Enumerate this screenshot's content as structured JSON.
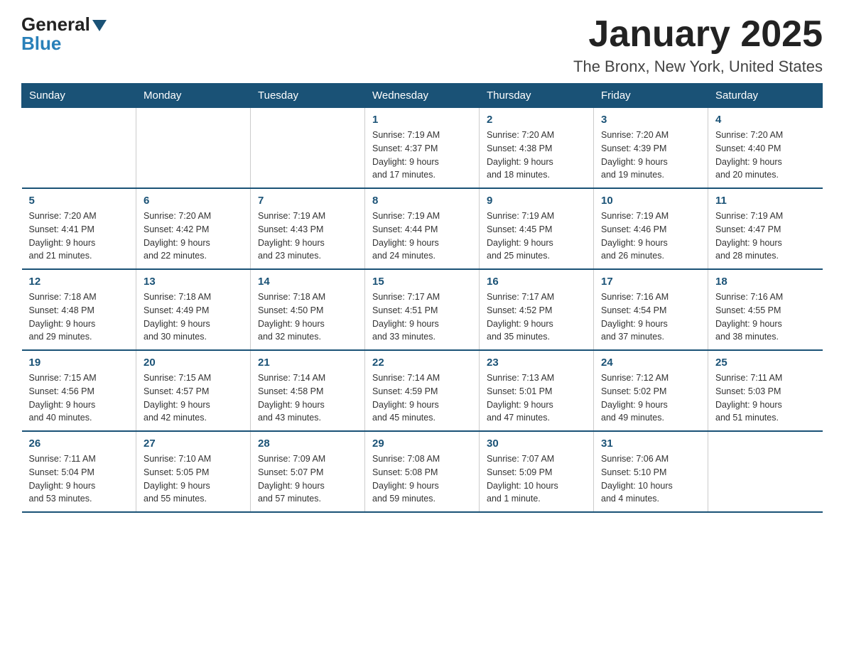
{
  "logo": {
    "general": "General",
    "blue": "Blue"
  },
  "header": {
    "month": "January 2025",
    "location": "The Bronx, New York, United States"
  },
  "weekdays": [
    "Sunday",
    "Monday",
    "Tuesday",
    "Wednesday",
    "Thursday",
    "Friday",
    "Saturday"
  ],
  "weeks": [
    [
      {
        "day": "",
        "info": ""
      },
      {
        "day": "",
        "info": ""
      },
      {
        "day": "",
        "info": ""
      },
      {
        "day": "1",
        "info": "Sunrise: 7:19 AM\nSunset: 4:37 PM\nDaylight: 9 hours\nand 17 minutes."
      },
      {
        "day": "2",
        "info": "Sunrise: 7:20 AM\nSunset: 4:38 PM\nDaylight: 9 hours\nand 18 minutes."
      },
      {
        "day": "3",
        "info": "Sunrise: 7:20 AM\nSunset: 4:39 PM\nDaylight: 9 hours\nand 19 minutes."
      },
      {
        "day": "4",
        "info": "Sunrise: 7:20 AM\nSunset: 4:40 PM\nDaylight: 9 hours\nand 20 minutes."
      }
    ],
    [
      {
        "day": "5",
        "info": "Sunrise: 7:20 AM\nSunset: 4:41 PM\nDaylight: 9 hours\nand 21 minutes."
      },
      {
        "day": "6",
        "info": "Sunrise: 7:20 AM\nSunset: 4:42 PM\nDaylight: 9 hours\nand 22 minutes."
      },
      {
        "day": "7",
        "info": "Sunrise: 7:19 AM\nSunset: 4:43 PM\nDaylight: 9 hours\nand 23 minutes."
      },
      {
        "day": "8",
        "info": "Sunrise: 7:19 AM\nSunset: 4:44 PM\nDaylight: 9 hours\nand 24 minutes."
      },
      {
        "day": "9",
        "info": "Sunrise: 7:19 AM\nSunset: 4:45 PM\nDaylight: 9 hours\nand 25 minutes."
      },
      {
        "day": "10",
        "info": "Sunrise: 7:19 AM\nSunset: 4:46 PM\nDaylight: 9 hours\nand 26 minutes."
      },
      {
        "day": "11",
        "info": "Sunrise: 7:19 AM\nSunset: 4:47 PM\nDaylight: 9 hours\nand 28 minutes."
      }
    ],
    [
      {
        "day": "12",
        "info": "Sunrise: 7:18 AM\nSunset: 4:48 PM\nDaylight: 9 hours\nand 29 minutes."
      },
      {
        "day": "13",
        "info": "Sunrise: 7:18 AM\nSunset: 4:49 PM\nDaylight: 9 hours\nand 30 minutes."
      },
      {
        "day": "14",
        "info": "Sunrise: 7:18 AM\nSunset: 4:50 PM\nDaylight: 9 hours\nand 32 minutes."
      },
      {
        "day": "15",
        "info": "Sunrise: 7:17 AM\nSunset: 4:51 PM\nDaylight: 9 hours\nand 33 minutes."
      },
      {
        "day": "16",
        "info": "Sunrise: 7:17 AM\nSunset: 4:52 PM\nDaylight: 9 hours\nand 35 minutes."
      },
      {
        "day": "17",
        "info": "Sunrise: 7:16 AM\nSunset: 4:54 PM\nDaylight: 9 hours\nand 37 minutes."
      },
      {
        "day": "18",
        "info": "Sunrise: 7:16 AM\nSunset: 4:55 PM\nDaylight: 9 hours\nand 38 minutes."
      }
    ],
    [
      {
        "day": "19",
        "info": "Sunrise: 7:15 AM\nSunset: 4:56 PM\nDaylight: 9 hours\nand 40 minutes."
      },
      {
        "day": "20",
        "info": "Sunrise: 7:15 AM\nSunset: 4:57 PM\nDaylight: 9 hours\nand 42 minutes."
      },
      {
        "day": "21",
        "info": "Sunrise: 7:14 AM\nSunset: 4:58 PM\nDaylight: 9 hours\nand 43 minutes."
      },
      {
        "day": "22",
        "info": "Sunrise: 7:14 AM\nSunset: 4:59 PM\nDaylight: 9 hours\nand 45 minutes."
      },
      {
        "day": "23",
        "info": "Sunrise: 7:13 AM\nSunset: 5:01 PM\nDaylight: 9 hours\nand 47 minutes."
      },
      {
        "day": "24",
        "info": "Sunrise: 7:12 AM\nSunset: 5:02 PM\nDaylight: 9 hours\nand 49 minutes."
      },
      {
        "day": "25",
        "info": "Sunrise: 7:11 AM\nSunset: 5:03 PM\nDaylight: 9 hours\nand 51 minutes."
      }
    ],
    [
      {
        "day": "26",
        "info": "Sunrise: 7:11 AM\nSunset: 5:04 PM\nDaylight: 9 hours\nand 53 minutes."
      },
      {
        "day": "27",
        "info": "Sunrise: 7:10 AM\nSunset: 5:05 PM\nDaylight: 9 hours\nand 55 minutes."
      },
      {
        "day": "28",
        "info": "Sunrise: 7:09 AM\nSunset: 5:07 PM\nDaylight: 9 hours\nand 57 minutes."
      },
      {
        "day": "29",
        "info": "Sunrise: 7:08 AM\nSunset: 5:08 PM\nDaylight: 9 hours\nand 59 minutes."
      },
      {
        "day": "30",
        "info": "Sunrise: 7:07 AM\nSunset: 5:09 PM\nDaylight: 10 hours\nand 1 minute."
      },
      {
        "day": "31",
        "info": "Sunrise: 7:06 AM\nSunset: 5:10 PM\nDaylight: 10 hours\nand 4 minutes."
      },
      {
        "day": "",
        "info": ""
      }
    ]
  ]
}
